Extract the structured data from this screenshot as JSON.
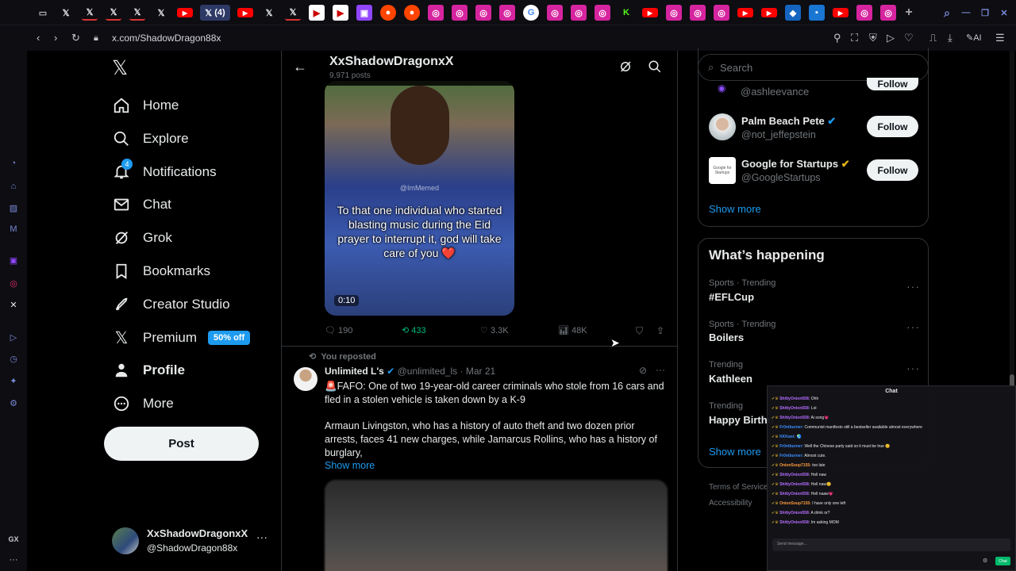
{
  "browser": {
    "url": "x.com/ShadowDragon88x",
    "notif_tab_badge": "(4)",
    "ai_label": "AI"
  },
  "nav": {
    "items": [
      {
        "label": "Home",
        "icon": "home-icon"
      },
      {
        "label": "Explore",
        "icon": "search-icon"
      },
      {
        "label": "Notifications",
        "icon": "bell-icon",
        "badge": "4"
      },
      {
        "label": "Chat",
        "icon": "mail-icon"
      },
      {
        "label": "Grok",
        "icon": "grok-icon"
      },
      {
        "label": "Bookmarks",
        "icon": "bookmark-icon"
      },
      {
        "label": "Creator Studio",
        "icon": "rocket-icon"
      },
      {
        "label": "Premium",
        "icon": "x-logo-icon",
        "badge": "50% off"
      },
      {
        "label": "Profile",
        "icon": "person-icon"
      },
      {
        "label": "More",
        "icon": "more-circle-icon"
      }
    ],
    "post_label": "Post",
    "account": {
      "name": "XxShadowDragonxX",
      "handle": "@ShadowDragon88x"
    }
  },
  "profile_header": {
    "name": "XxShadowDragonxX",
    "posts": "9,971 posts"
  },
  "video_post": {
    "watermark": "@ImMemed",
    "caption": "To that one individual who started blasting music during the Eid prayer to interrupt it, god will take care of you ❤️",
    "duration": "0:10",
    "replies": "190",
    "reposts": "433",
    "likes": "3.3K",
    "views": "48K"
  },
  "repost": {
    "context": "You reposted",
    "name": "Unlimited L's",
    "handle": "@unlimited_ls",
    "date": "· Mar 21",
    "text1": "🚨FAFO: One of two 19-year-old career criminals who stole from 16 cars and fled in a stolen vehicle is taken down by a K-9",
    "text2": "Armaun Livingston, who has a history of auto theft and two dozen prior arrests, faces 41 new charges, while Jamarcus Rollins, who has a history of burglary,",
    "show_more": "Show more"
  },
  "search": {
    "placeholder": "Search"
  },
  "who_to_follow": {
    "partial_handle": "@ashleevance",
    "partial_follow": "Follow",
    "items": [
      {
        "name": "Palm Beach Pete",
        "handle": "@not_jeffepstein",
        "follow": "Follow",
        "verified": "#1d9bf0"
      },
      {
        "name": "Google for Startups",
        "handle": "@GoogleStartups",
        "follow": "Follow",
        "verified": "#e2b719",
        "avatar_text": "Google for Startups"
      }
    ],
    "show_more": "Show more"
  },
  "happening": {
    "title": "What’s happening",
    "trends": [
      {
        "category": "Sports · Trending",
        "name": "#EFLCup"
      },
      {
        "category": "Sports · Trending",
        "name": "Boilers"
      },
      {
        "category": "Trending",
        "name": "Kathleen"
      },
      {
        "category": "Trending",
        "name": "Happy Birthd"
      }
    ],
    "show_more": "Show more"
  },
  "footer": {
    "terms": "Terms of Service",
    "accessibility": "Accessibility"
  },
  "chat": {
    "title": "Chat",
    "messages": [
      {
        "user": "ShittyOnion558:",
        "text": "Ohh",
        "color": "purple"
      },
      {
        "user": "ShittyOnion558:",
        "text": "Lol",
        "color": "purple"
      },
      {
        "user": "ShittyOnion558:",
        "text": "Ai song💗",
        "color": "purple"
      },
      {
        "user": "Fr0ntburner:",
        "text": "Communist manifesto still a bestseller available almost everywhere",
        "color": "blue"
      },
      {
        "user": "KKKant:",
        "text": "🌏",
        "color": "blue"
      },
      {
        "user": "Fr0ntburner:",
        "text": "Well the Chinese party said so it must be true 😊",
        "color": "blue"
      },
      {
        "user": "Fr0ntburner:",
        "text": "Almost cute.",
        "color": "blue"
      },
      {
        "user": "OnionSoup7155:",
        "text": "too late",
        "color": "orange"
      },
      {
        "user": "ShittyOnion558:",
        "text": "Hell naw",
        "color": "purple"
      },
      {
        "user": "ShittyOnion558:",
        "text": "Hell naw😊",
        "color": "purple"
      },
      {
        "user": "ShittyOnion558:",
        "text": "Hell naaw💗",
        "color": "purple"
      },
      {
        "user": "OnionSoup7155:",
        "text": "I have only one left",
        "color": "orange"
      },
      {
        "user": "ShittyOnion558:",
        "text": "A drink or?",
        "color": "purple"
      },
      {
        "user": "ShittyOnion558:",
        "text": "Im asking MOM",
        "color": "purple"
      }
    ],
    "input_placeholder": "Send message...",
    "send_label": "Chat"
  },
  "colors": {
    "accent": "#1d9bf0",
    "repost_green": "#00ba7c",
    "bg": "#000000",
    "border": "#2f3336"
  }
}
